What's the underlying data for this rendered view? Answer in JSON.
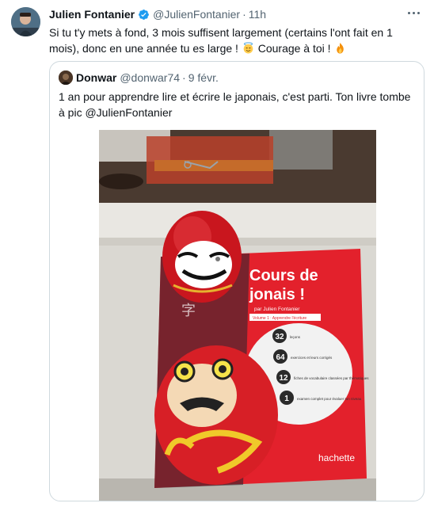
{
  "tweet": {
    "author_name": "Julien Fontanier",
    "author_handle": "@JulienFontanier",
    "time": "11h",
    "text_part1": "Si tu t'y mets à fond, 3 mois suffisent largement (certains l'ont fait en 1 mois), donc en une année tu es large !",
    "text_part2": "Courage à toi !",
    "icons": {
      "verified": "verified-badge-icon",
      "more": "more-options-icon",
      "emoji1": "smiling-face-with-halo-emoji",
      "emoji2": "fire-emoji"
    }
  },
  "quote": {
    "author_name": "Donwar",
    "author_handle": "@donwar74",
    "date": "9 févr.",
    "text": "1 an pour apprendre lire et écrire le japonais, c'est parti. Ton livre tombe à pic @JulienFontanier"
  },
  "book": {
    "title_line1": "Cours de",
    "title_line2": "jonais !",
    "author": "par Julien Fontanier",
    "volume": "Volume 1 : Apprendre l'écriture",
    "stats": [
      {
        "num": "32",
        "label": "leçons"
      },
      {
        "num": "64",
        "label": "exercices et leurs corrigés"
      },
      {
        "num": "12",
        "label": "fiches de vocabulaire classées par thématiques"
      },
      {
        "num": "1",
        "label": "examen complet pour évaluer ton niveau"
      }
    ],
    "publisher": "hachette",
    "kanji": "字"
  },
  "colors": {
    "text": "#0f1419",
    "muted": "#536471",
    "border": "#cfd9de",
    "verified": "#1d9bf0",
    "book_red": "#e3212c"
  }
}
